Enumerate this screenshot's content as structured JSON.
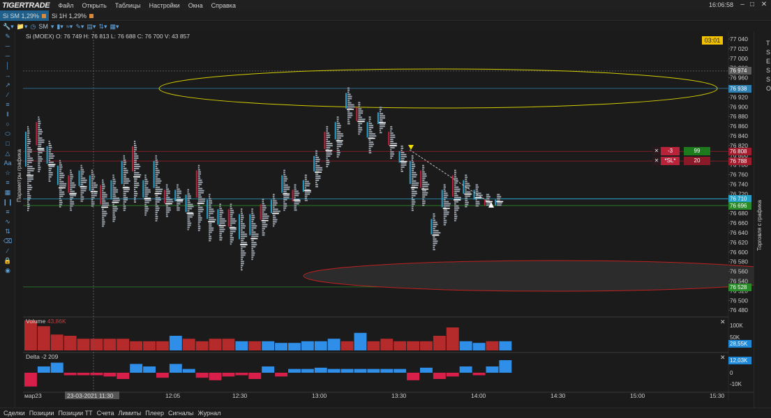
{
  "app": {
    "logo": "TIGERTRADE",
    "menu": [
      "Файл",
      "Открыть",
      "Таблицы",
      "Настройки",
      "Окна",
      "Справка"
    ],
    "clock": "16:06:58"
  },
  "tabs": [
    {
      "label": "Si SM  1,29%",
      "active": true,
      "color": "#d88a3a"
    },
    {
      "label": "Si 1H  1,29%",
      "active": false,
      "color": "#d88a3a"
    }
  ],
  "toolbar": {
    "timeframe": "SM"
  },
  "chart": {
    "ohlc": "Si (MOEX) O: 76 749  H: 76 813  L: 76 688  C: 76 700  V: 43 857",
    "timer": "03:01",
    "side_left_label": "Параметры графика",
    "side_right_label": "Торговля с графика",
    "side_letters": [
      "T",
      "S",
      "E",
      "S",
      "S",
      "O"
    ],
    "price_axis": [
      "77 040",
      "77 020",
      "77 000",
      "76 980",
      "76 960",
      "76 940",
      "76 920",
      "76 900",
      "76 880",
      "76 860",
      "76 840",
      "76 820",
      "76 800",
      "76 780",
      "76 760",
      "76 740",
      "76 720",
      "76 700",
      "76 680",
      "76 660",
      "76 640",
      "76 620",
      "76 600",
      "76 580",
      "76 560",
      "76 540",
      "76 520",
      "76 500",
      "76 480"
    ],
    "price_tags": [
      {
        "label": "76 974",
        "color": "#5a5a5a"
      },
      {
        "label": "76 938",
        "color": "#2f7fb0"
      },
      {
        "label": "76 808",
        "color": "#a01c2c"
      },
      {
        "label": "76 788",
        "color": "#a01c2c"
      },
      {
        "label": "76 710",
        "color": "#27a0c8"
      },
      {
        "label": "76 696",
        "color": "#2a8a2a"
      },
      {
        "label": "76 528",
        "color": "#2a8a2a"
      }
    ],
    "time_axis": [
      "мар23",
      "23-03-2021 11:30",
      "12:05",
      "12:30",
      "13:00",
      "13:30",
      "14:00",
      "14:30",
      "15:00",
      "15:30"
    ],
    "orders": [
      {
        "x": "✕",
        "qty": "-3",
        "value": "99",
        "value_color": "#1d7a1d"
      },
      {
        "x": "✕",
        "qty": "*SL*",
        "value": "20",
        "value_color": "#8a1a28"
      }
    ]
  },
  "volume_panel": {
    "label": "Volume",
    "value": "43,86K",
    "axis": [
      "100K",
      "50K"
    ],
    "current": "28,55K",
    "bars": [
      {
        "v": 72,
        "color": "red"
      },
      {
        "v": 58,
        "color": "red"
      },
      {
        "v": 38,
        "color": "red"
      },
      {
        "v": 35,
        "color": "red"
      },
      {
        "v": 28,
        "color": "red"
      },
      {
        "v": 28,
        "color": "red"
      },
      {
        "v": 28,
        "color": "red"
      },
      {
        "v": 28,
        "color": "red"
      },
      {
        "v": 22,
        "color": "red"
      },
      {
        "v": 22,
        "color": "red"
      },
      {
        "v": 22,
        "color": "red"
      },
      {
        "v": 35,
        "color": "blue"
      },
      {
        "v": 28,
        "color": "red"
      },
      {
        "v": 22,
        "color": "red"
      },
      {
        "v": 28,
        "color": "red"
      },
      {
        "v": 28,
        "color": "red"
      },
      {
        "v": 22,
        "color": "blue"
      },
      {
        "v": 22,
        "color": "red"
      },
      {
        "v": 22,
        "color": "blue"
      },
      {
        "v": 18,
        "color": "blue"
      },
      {
        "v": 18,
        "color": "blue"
      },
      {
        "v": 22,
        "color": "blue"
      },
      {
        "v": 22,
        "color": "blue"
      },
      {
        "v": 28,
        "color": "blue"
      },
      {
        "v": 22,
        "color": "red"
      },
      {
        "v": 42,
        "color": "blue"
      },
      {
        "v": 22,
        "color": "red"
      },
      {
        "v": 28,
        "color": "red"
      },
      {
        "v": 22,
        "color": "red"
      },
      {
        "v": 22,
        "color": "red"
      },
      {
        "v": 22,
        "color": "red"
      },
      {
        "v": 35,
        "color": "red"
      },
      {
        "v": 55,
        "color": "red"
      },
      {
        "v": 22,
        "color": "blue"
      },
      {
        "v": 18,
        "color": "blue"
      },
      {
        "v": 22,
        "color": "red"
      },
      {
        "v": 22,
        "color": "blue"
      }
    ]
  },
  "delta_panel": {
    "label": "Delta",
    "value": "-2 209",
    "axis": [
      "0",
      "-10K"
    ],
    "current": "12,03K",
    "bars": [
      {
        "v": -11
      },
      {
        "v": 5
      },
      {
        "v": 8
      },
      {
        "v": -2
      },
      {
        "v": -2
      },
      {
        "v": -2
      },
      {
        "v": -3
      },
      {
        "v": -5
      },
      {
        "v": 7
      },
      {
        "v": 5
      },
      {
        "v": -4
      },
      {
        "v": 7
      },
      {
        "v": 3
      },
      {
        "v": -4
      },
      {
        "v": -6
      },
      {
        "v": -3
      },
      {
        "v": -2
      },
      {
        "v": -5
      },
      {
        "v": 5
      },
      {
        "v": -3
      },
      {
        "v": 3
      },
      {
        "v": 3
      },
      {
        "v": 4
      },
      {
        "v": 3
      },
      {
        "v": 3
      },
      {
        "v": 3
      },
      {
        "v": 3
      },
      {
        "v": 3
      },
      {
        "v": 3
      },
      {
        "v": -6
      },
      {
        "v": 4
      },
      {
        "v": -5
      },
      {
        "v": -3
      },
      {
        "v": 5
      },
      {
        "v": -2
      },
      {
        "v": 5
      },
      {
        "v": 10
      }
    ]
  },
  "bottom_tabs": [
    "Сделки",
    "Позиции",
    "Позиции ТТ",
    "Счета",
    "Лимиты",
    "Плеер",
    "Сигналы",
    "Журнал"
  ]
}
